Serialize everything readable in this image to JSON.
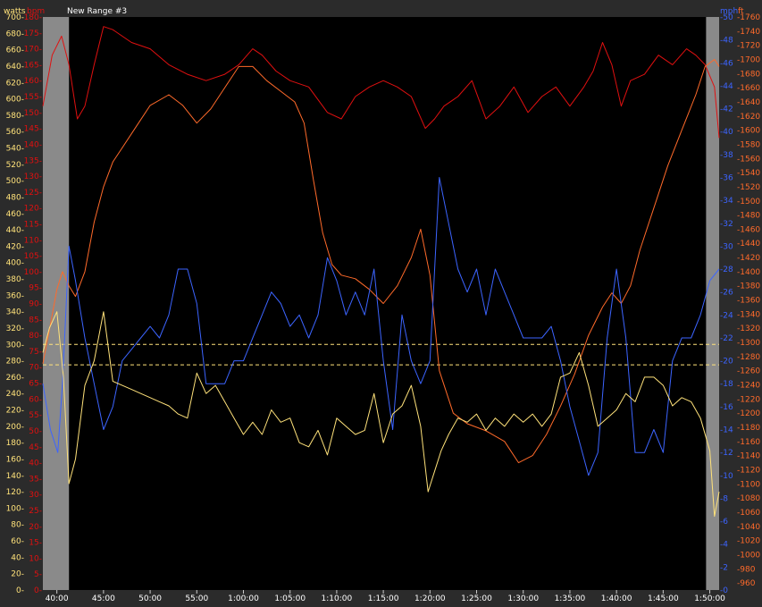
{
  "range_label": "New Range #3",
  "colors": {
    "background": "#000000",
    "frame": "#2b2b2b",
    "shade": "#8a8a8a",
    "watts": "#ffe27a",
    "bpm": "#e01010",
    "mph": "#3c64ff",
    "ft": "#ff6a2a",
    "ref_line": "#ffe27a"
  },
  "chart_data": {
    "type": "line",
    "x_unit": "elapsed time (minutes)",
    "xlim": [
      38.5,
      111
    ],
    "x_ticks": [
      {
        "v": 40,
        "label": "40:00"
      },
      {
        "v": 45,
        "label": "45:00"
      },
      {
        "v": 50,
        "label": "50:00"
      },
      {
        "v": 55,
        "label": "55:00"
      },
      {
        "v": 60,
        "label": "1:00:00"
      },
      {
        "v": 65,
        "label": "1:05:00"
      },
      {
        "v": 70,
        "label": "1:10:00"
      },
      {
        "v": 75,
        "label": "1:15:00"
      },
      {
        "v": 80,
        "label": "1:20:00"
      },
      {
        "v": 85,
        "label": "1:25:00"
      },
      {
        "v": 90,
        "label": "1:30:00"
      },
      {
        "v": 95,
        "label": "1:35:00"
      },
      {
        "v": 100,
        "label": "1:40:00"
      },
      {
        "v": 105,
        "label": "1:45:00"
      },
      {
        "v": 110,
        "label": "1:50:00"
      }
    ],
    "shaded_ranges": [
      [
        38.5,
        41.3
      ],
      [
        109.6,
        111
      ]
    ],
    "axes": {
      "watts": {
        "label": "watts",
        "min": 0,
        "max": 700,
        "step": 20,
        "ticks": [
          "0-",
          "20-",
          "40-",
          "60-",
          "80-",
          "100-",
          "120-",
          "140-",
          "160-",
          "180-",
          "200-",
          "220-",
          "240-",
          "260-",
          "280-",
          "300-",
          "320-",
          "340-",
          "360-",
          "380-",
          "400-",
          "420-",
          "440-",
          "460-",
          "480-",
          "500-",
          "520-",
          "540-",
          "560-",
          "580-",
          "600-",
          "620-",
          "640-",
          "660-",
          "680-",
          "700-"
        ]
      },
      "bpm": {
        "label": "bpm",
        "min": 0,
        "max": 180,
        "step": 5,
        "ticks": [
          "0-",
          "5-",
          "10-",
          "15-",
          "20-",
          "25-",
          "30-",
          "35-",
          "40-",
          "45-",
          "50-",
          "55-",
          "60-",
          "65-",
          "70-",
          "75-",
          "80-",
          "85-",
          "90-",
          "95-",
          "100-",
          "105-",
          "110-",
          "115-",
          "120-",
          "125-",
          "130-",
          "135-",
          "140-",
          "145-",
          "150-",
          "155-",
          "160-",
          "165-",
          "170-",
          "175-",
          "180-"
        ]
      },
      "mph": {
        "label": "mph",
        "min": 0,
        "max": 50,
        "step": 2,
        "ticks": [
          "-0",
          "-2",
          "-4",
          "-6",
          "-8",
          "-10",
          "-12",
          "-14",
          "-16",
          "-18",
          "-20",
          "-22",
          "-24",
          "-26",
          "-28",
          "-30",
          "-32",
          "-34",
          "-36",
          "-38",
          "-40",
          "-42",
          "-44",
          "-46",
          "-48",
          "-50"
        ]
      },
      "ft": {
        "label": "ft",
        "min": 950,
        "max": 1760,
        "step": 20,
        "ticks": [
          "-960",
          "-980",
          "-1000",
          "-1020",
          "-1040",
          "-1060",
          "-1080",
          "-1100",
          "-1120",
          "-1140",
          "-1160",
          "-1180",
          "-1200",
          "-1220",
          "-1240",
          "-1260",
          "-1280",
          "-1300",
          "-1320",
          "-1340",
          "-1360",
          "-1380",
          "-1400",
          "-1420",
          "-1440",
          "-1460",
          "-1480",
          "-1500",
          "-1520",
          "-1540",
          "-1560",
          "-1580",
          "-1600",
          "-1620",
          "-1640",
          "-1660",
          "-1680",
          "-1700",
          "-1720",
          "-1740",
          "-1760"
        ]
      }
    },
    "reference_lines_watts": [
      300,
      275
    ],
    "series": [
      {
        "name": "bpm",
        "axis": "bpm",
        "x": [
          38.5,
          39.5,
          40.5,
          41.3,
          42.2,
          43,
          44,
          45,
          46,
          48,
          50,
          52,
          54,
          56,
          58,
          59.5,
          61,
          62,
          63.5,
          65,
          67,
          69,
          70.5,
          72,
          73.5,
          75,
          76.5,
          78,
          79.5,
          80.5,
          81.5,
          83,
          84.5,
          86,
          87.5,
          89,
          90.5,
          92,
          93.5,
          95,
          96.5,
          97.5,
          98.5,
          99.5,
          100.5,
          101.5,
          103,
          104.5,
          106,
          107.5,
          108.5,
          109.5,
          110.5,
          111
        ],
        "y": [
          152,
          168,
          174,
          165,
          148,
          152,
          165,
          177,
          176,
          172,
          170,
          165,
          162,
          160,
          162,
          165,
          170,
          168,
          163,
          160,
          158,
          150,
          148,
          155,
          158,
          160,
          158,
          155,
          145,
          148,
          152,
          155,
          160,
          148,
          152,
          158,
          150,
          155,
          158,
          152,
          158,
          163,
          172,
          165,
          152,
          160,
          162,
          168,
          165,
          170,
          168,
          165,
          158,
          142
        ]
      },
      {
        "name": "ft",
        "axis": "ft",
        "x": [
          38.5,
          39.3,
          40,
          40.6,
          41.3,
          42,
          43,
          44,
          45,
          46,
          47,
          48.5,
          50,
          52,
          53.5,
          55,
          56.5,
          58,
          59.5,
          61,
          62.5,
          64,
          65.5,
          66.5,
          67.5,
          68.5,
          69.5,
          70.5,
          72,
          73.5,
          75,
          76.5,
          78,
          79,
          80,
          81,
          82.5,
          84,
          86,
          88,
          89.5,
          91,
          92.5,
          94,
          95.5,
          97,
          98.5,
          99.5,
          100.5,
          101.5,
          102.5,
          104,
          105.5,
          107,
          108.5,
          109.5,
          110.5,
          111
        ],
        "y": [
          1270,
          1325,
          1375,
          1400,
          1380,
          1365,
          1400,
          1470,
          1520,
          1555,
          1575,
          1605,
          1635,
          1650,
          1635,
          1610,
          1630,
          1660,
          1690,
          1690,
          1670,
          1655,
          1640,
          1610,
          1530,
          1455,
          1410,
          1395,
          1390,
          1375,
          1355,
          1380,
          1420,
          1460,
          1395,
          1260,
          1200,
          1185,
          1175,
          1160,
          1130,
          1140,
          1170,
          1210,
          1255,
          1310,
          1350,
          1370,
          1355,
          1380,
          1430,
          1490,
          1550,
          1600,
          1650,
          1690,
          1700,
          1690
        ]
      },
      {
        "name": "mph",
        "axis": "mph",
        "x": [
          38.5,
          39.3,
          40.1,
          40.6,
          41.3,
          42,
          43,
          44,
          45,
          46,
          47,
          48,
          49,
          50,
          51,
          52,
          53,
          54,
          55,
          56,
          57,
          58,
          59,
          60,
          61,
          62,
          63,
          64,
          65,
          66,
          67,
          68,
          69,
          70,
          71,
          72,
          73,
          74,
          75,
          76,
          77,
          78,
          79,
          80,
          81,
          82,
          83,
          84,
          85,
          86,
          87,
          88,
          89,
          90,
          91,
          92,
          93,
          94,
          95,
          96,
          97,
          98,
          99,
          100,
          101,
          102,
          103,
          104,
          105,
          106,
          107,
          108,
          109,
          110,
          111
        ],
        "y": [
          18,
          14,
          12,
          18,
          30,
          27,
          22,
          18,
          14,
          16,
          20,
          21,
          22,
          23,
          22,
          24,
          28,
          28,
          25,
          18,
          18,
          18,
          20,
          20,
          22,
          24,
          26,
          25,
          23,
          24,
          22,
          24,
          29,
          27,
          24,
          26,
          24,
          28,
          20,
          14,
          24,
          20,
          18,
          20,
          36,
          32,
          28,
          26,
          28,
          24,
          28,
          26,
          24,
          22,
          22,
          22,
          23,
          20,
          16,
          13,
          10,
          12,
          22,
          28,
          22,
          12,
          12,
          14,
          12,
          20,
          22,
          22,
          24,
          27,
          28
        ]
      },
      {
        "name": "watts",
        "axis": "watts",
        "x": [
          38.5,
          39.2,
          40,
          40.7,
          41.3,
          42,
          43,
          44,
          45,
          46,
          47,
          48,
          49,
          50,
          51,
          52,
          53,
          54,
          55,
          56,
          57,
          58,
          59,
          60,
          61,
          62,
          63,
          64,
          65,
          66,
          67,
          68,
          69,
          70,
          71,
          72,
          73,
          74,
          75,
          76,
          77,
          78,
          79,
          79.8,
          80.5,
          81.2,
          82,
          83,
          84,
          85,
          86,
          87,
          88,
          89,
          90,
          91,
          92,
          93,
          94,
          95,
          96,
          97,
          98,
          99,
          100,
          101,
          102,
          103,
          104,
          105,
          106,
          107,
          108,
          109,
          110,
          110.5,
          111
        ],
        "y": [
          290,
          320,
          340,
          260,
          130,
          160,
          250,
          280,
          340,
          255,
          250,
          245,
          240,
          235,
          230,
          225,
          215,
          210,
          265,
          240,
          250,
          230,
          210,
          190,
          205,
          190,
          220,
          205,
          210,
          180,
          175,
          195,
          165,
          210,
          200,
          190,
          195,
          240,
          180,
          215,
          225,
          250,
          200,
          120,
          145,
          170,
          190,
          210,
          205,
          215,
          195,
          210,
          200,
          215,
          205,
          215,
          200,
          215,
          260,
          265,
          290,
          250,
          200,
          210,
          220,
          240,
          230,
          260,
          260,
          250,
          225,
          235,
          230,
          210,
          170,
          90,
          120
        ]
      }
    ]
  }
}
